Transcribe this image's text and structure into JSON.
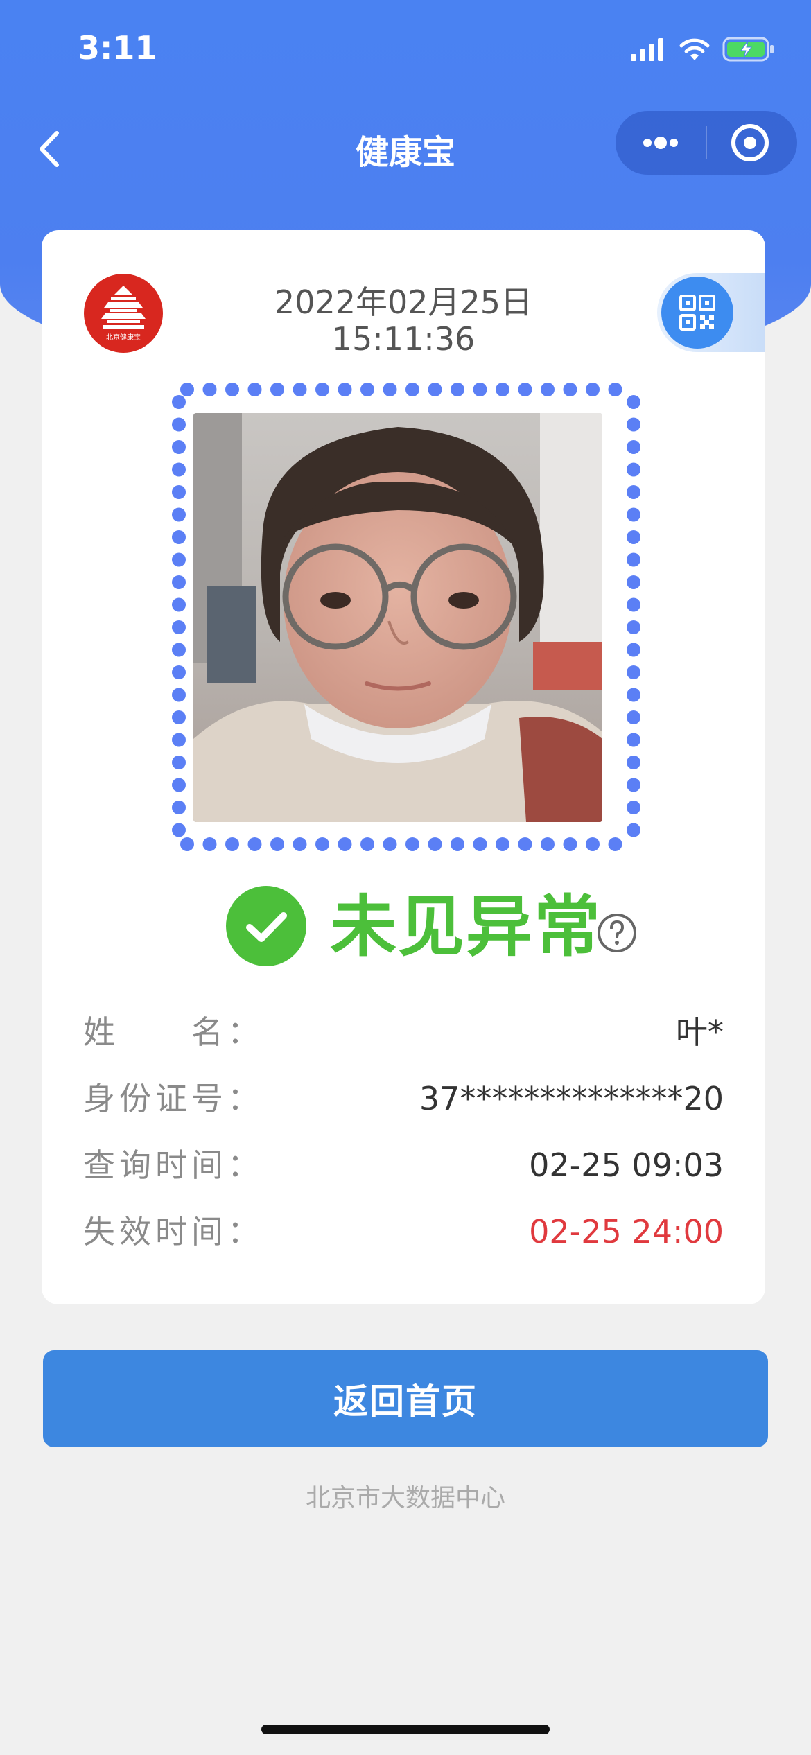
{
  "status_bar": {
    "time": "3:11"
  },
  "nav": {
    "title": "健康宝",
    "back_icon": "chevron-left-icon",
    "more_icon": "more-dots-icon",
    "close_icon": "target-circle-icon"
  },
  "card": {
    "logo_text": "北京健康宝",
    "date": "2022年02月25日",
    "time": "15:11:36",
    "qr_icon": "qr-code-icon",
    "status": {
      "text": "未见异常",
      "color": "#4cbf3a",
      "icon": "check-circle-icon",
      "help_icon": "help-circle-icon"
    },
    "frame_dot_color": "#5b7ff5",
    "info": [
      {
        "label": "姓　　名：",
        "value": "叶*"
      },
      {
        "label": "身份证号：",
        "value": "37**************20"
      },
      {
        "label": "查询时间：",
        "value": "02-25 09:03"
      },
      {
        "label": "失效时间：",
        "value": "02-25 24:00",
        "value_color": "#e0393e"
      }
    ]
  },
  "home_button": {
    "label": "返回首页"
  },
  "footer": {
    "text": "北京市大数据中心"
  },
  "colors": {
    "header_blue": "#4a82f2",
    "button_blue": "#3d87e0",
    "expiry_red": "#e0393e"
  }
}
